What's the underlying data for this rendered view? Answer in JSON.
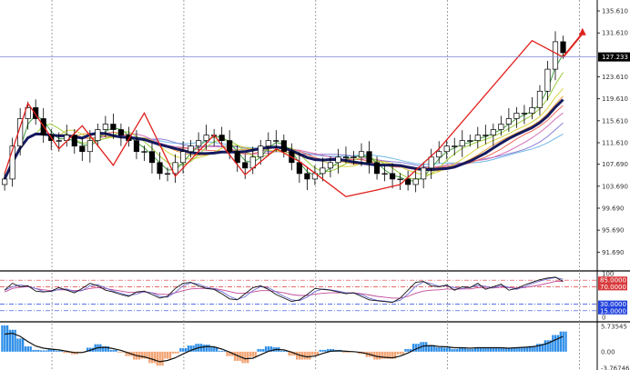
{
  "colors": {
    "background": "#ffffff",
    "grid": "#8c8c8c",
    "axis": "#000000",
    "candle": "#000000",
    "zigzag": "#e0201c",
    "slow_ma": "#151a5e",
    "last_price_line": "#7b86d6",
    "rsi_fast": "#111111",
    "rsi_slow": "#c24a9a",
    "rsi_mid": "#6e6ed6",
    "level_high": "#d8393b",
    "level_low": "#2244dd",
    "hist_pos": "#2f8fe8",
    "hist_neg": "#f2a372",
    "signal": "#101010",
    "fan": [
      "#3f9f3f",
      "#9acd3c",
      "#d6d33f",
      "#f0a23a",
      "#ee6b5b",
      "#d26fb4",
      "#8a7fd8",
      "#6fb7e6"
    ]
  },
  "chart_data": [
    {
      "type": "candlestick",
      "panel": "price",
      "ylim": [
        88.6,
        137.6
      ],
      "y_ticks": [
        "135.610",
        "131.610",
        "127.233",
        "123.610",
        "119.610",
        "115.610",
        "111.610",
        "107.690",
        "103.690",
        "99.690",
        "95.690",
        "91.690"
      ],
      "last_price": 127.233,
      "last_price_label": "127.233",
      "grid": "vertical-dotted",
      "close": [
        105,
        111,
        116,
        118,
        116,
        113,
        112,
        112,
        113,
        111,
        110,
        112,
        114,
        115,
        114,
        113,
        112,
        110,
        110,
        108,
        106,
        106,
        108,
        110,
        111,
        112,
        113,
        113,
        112,
        110,
        108,
        107,
        109,
        111,
        112,
        112,
        110,
        108,
        106,
        105,
        106,
        107,
        108,
        109,
        109,
        109,
        110,
        108,
        106,
        106,
        105,
        105,
        104,
        105,
        107,
        109,
        110,
        111,
        111,
        112,
        112,
        113,
        113,
        114,
        115,
        116,
        117,
        117,
        118,
        121,
        125,
        130,
        128
      ],
      "zigzag": {
        "x": [
          0,
          3,
          7,
          10,
          14,
          18,
          22,
          27,
          31,
          35,
          38,
          44,
          48,
          51,
          56,
          68,
          72
        ],
        "y": [
          106,
          118.8,
          110.5,
          114.7,
          107.5,
          117,
          105.5,
          113,
          105.8,
          110.5,
          108.2,
          101.8,
          103,
          104,
          110.5,
          130.2,
          127.2
        ]
      },
      "forecast_arrow": {
        "x": [
          72,
          74.5
        ],
        "y": [
          127.2,
          132.5
        ]
      },
      "ma_periods": [
        3,
        5,
        8,
        10,
        13,
        16,
        20,
        25
      ],
      "slow_ma_period": 11
    },
    {
      "type": "line",
      "panel": "oscillator",
      "ylim": [
        0,
        100
      ],
      "y_ticks": [
        "100",
        "0"
      ],
      "levels": [
        {
          "value": 85,
          "label": "85.0000"
        },
        {
          "value": 70,
          "label": "70.0000"
        },
        {
          "value": 30,
          "label": "30.0000"
        },
        {
          "value": 15,
          "label": "15.0000"
        }
      ],
      "series": [
        {
          "values": [
            62,
            78,
            70,
            72,
            60,
            58,
            60,
            68,
            62,
            56,
            66,
            78,
            72,
            62,
            58,
            52,
            48,
            58,
            60,
            52,
            44,
            48,
            66,
            78,
            80,
            72,
            66,
            64,
            54,
            42,
            40,
            54,
            68,
            72,
            64,
            52,
            44,
            36,
            40,
            52,
            66,
            64,
            62,
            58,
            54,
            56,
            48,
            40,
            38,
            36,
            34,
            44,
            62,
            80,
            82,
            72,
            70,
            74,
            62,
            70,
            68,
            78,
            64,
            70,
            76,
            62,
            66,
            74,
            80,
            86,
            90,
            92,
            82
          ]
        },
        {
          "values": [
            58,
            66,
            69,
            70,
            66,
            63,
            61,
            63,
            63,
            61,
            62,
            66,
            68,
            66,
            63,
            60,
            57,
            57,
            58,
            56,
            53,
            52,
            56,
            61,
            65,
            66,
            66,
            66,
            63,
            59,
            55,
            55,
            58,
            61,
            61,
            59,
            56,
            52,
            50,
            50,
            53,
            55,
            56,
            56,
            56,
            56,
            54,
            51,
            48,
            46,
            44,
            44,
            48,
            55,
            60,
            62,
            63,
            65,
            64,
            65,
            65,
            68,
            67,
            67,
            69,
            68,
            67,
            68,
            71,
            74,
            78,
            82,
            82
          ]
        }
      ]
    },
    {
      "type": "bar",
      "panel": "histogram",
      "ylim": [
        -3.76746,
        6.4
      ],
      "y_ticks": [
        "5.73545",
        "0.00",
        "-3.76746"
      ],
      "values": [
        6,
        5,
        3,
        1.2,
        0.4,
        0.3,
        0.5,
        0.2,
        -0.3,
        -0.6,
        -0.2,
        0.9,
        1.7,
        1.2,
        0.4,
        -0.2,
        -1,
        -1.8,
        -1.6,
        -2.6,
        -3.2,
        -1.6,
        -0.4,
        0.8,
        1.4,
        1.8,
        1.6,
        1,
        0.2,
        -1,
        -2.1,
        -2.6,
        -1.2,
        0.6,
        1.2,
        1,
        0.2,
        -0.9,
        -1.8,
        -1.8,
        -0.8,
        0.4,
        0.6,
        0.4,
        -0.2,
        -0.1,
        -0.5,
        -1.2,
        -1.8,
        -1.6,
        -1.6,
        -0.6,
        0.6,
        1.8,
        2.2,
        1.5,
        1,
        0.9,
        0.6,
        0.9,
        0.6,
        0.9,
        0.8,
        0.9,
        0.9,
        0.7,
        1,
        1.1,
        1.3,
        1.8,
        2.6,
        3.8,
        4.6
      ],
      "signal": [
        4,
        4.2,
        3.5,
        2.3,
        1.3,
        0.8,
        0.6,
        0.4,
        0.1,
        -0.2,
        -0.2,
        0.3,
        0.9,
        1,
        0.7,
        0.3,
        -0.3,
        -0.9,
        -1.2,
        -1.7,
        -2.3,
        -2,
        -1.4,
        -0.5,
        0.3,
        0.9,
        1.2,
        1.1,
        0.6,
        -0.1,
        -0.9,
        -1.6,
        -1.5,
        -0.7,
        0.1,
        0.5,
        0.4,
        -0.1,
        -0.8,
        -1.2,
        -1,
        -0.4,
        0.1,
        0.2,
        0.1,
        0,
        -0.2,
        -0.6,
        -1.1,
        -1.3,
        -1.4,
        -1,
        -0.3,
        0.6,
        1.3,
        1.4,
        1.2,
        1.1,
        0.9,
        0.9,
        0.8,
        0.9,
        0.9,
        0.9,
        0.9,
        0.8,
        0.9,
        1,
        1.1,
        1.4,
        1.9,
        2.7,
        3.5
      ]
    }
  ]
}
